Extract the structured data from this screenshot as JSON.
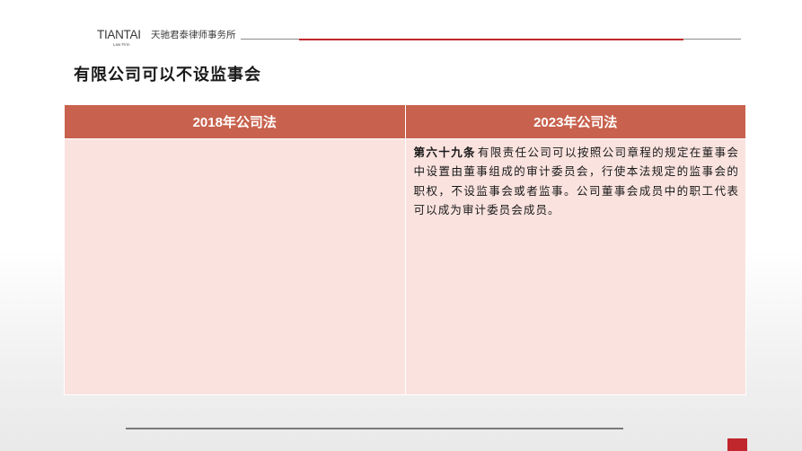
{
  "header": {
    "logo_en": "TIANTAI",
    "logo_sub": "Law Firm",
    "logo_cn": "天驰君泰律师事务所"
  },
  "title": "有限公司可以不设监事会",
  "table": {
    "columns": [
      "2018年公司法",
      "2023年公司法"
    ],
    "rows": [
      {
        "col_2018": "",
        "col_2023_article": "第六十九条",
        "col_2023_text": "有限责任公司可以按照公司章程的规定在董事会中设置由董事组成的审计委员会，行使本法规定的监事会的职权，不设监事会或者监事。公司董事会成员中的职工代表可以成为审计委员会成员。"
      }
    ]
  },
  "colors": {
    "header_fill": "#c8614d",
    "cell_fill": "#fae3df",
    "accent_red": "#c0272d"
  }
}
